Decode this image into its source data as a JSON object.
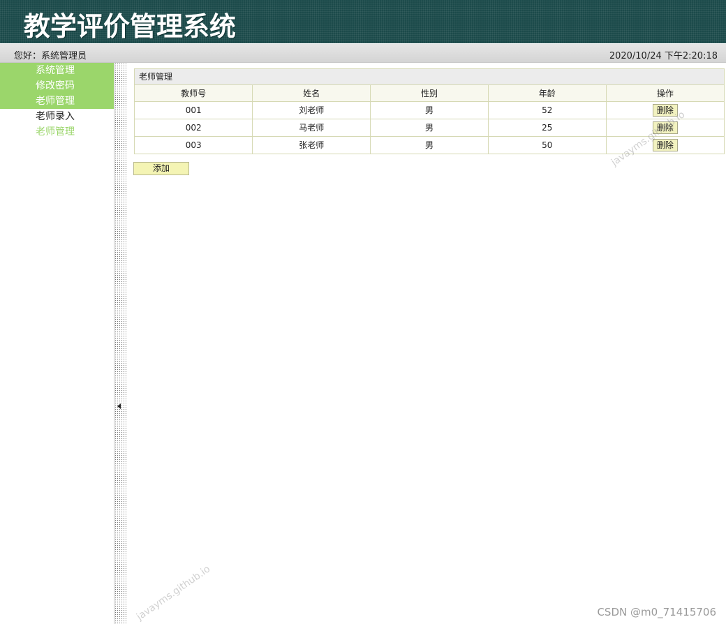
{
  "app": {
    "title": "教学评价管理系统"
  },
  "infobar": {
    "greeting": "您好：系统管理员",
    "datetime": "2020/10/24 下午2:20:18"
  },
  "sidebar": {
    "items": [
      {
        "label": "系统管理"
      },
      {
        "label": "修改密码"
      },
      {
        "label": "老师管理"
      },
      {
        "label": "老师录入"
      },
      {
        "label": "老师管理"
      }
    ]
  },
  "panel": {
    "title": "老师管理",
    "columns": [
      "教师号",
      "姓名",
      "性别",
      "年龄",
      "操作"
    ],
    "rows": [
      {
        "id": "001",
        "name": "刘老师",
        "gender": "男",
        "age": "52",
        "action": "删除"
      },
      {
        "id": "002",
        "name": "马老师",
        "gender": "男",
        "age": "25",
        "action": "删除"
      },
      {
        "id": "003",
        "name": "张老师",
        "gender": "男",
        "age": "50",
        "action": "删除"
      }
    ]
  },
  "add_button": {
    "label": "添加"
  },
  "watermarks": {
    "site": "javayms.github.io",
    "csdn": "CSDN @m0_71415706"
  },
  "colors": {
    "header_bg": "#1b4a4a",
    "menu_green": "#9bd66b",
    "button_yellow": "#f4f4b4",
    "table_border": "#d6d9b4"
  },
  "icons": {
    "splitter": "caret-left-icon"
  }
}
